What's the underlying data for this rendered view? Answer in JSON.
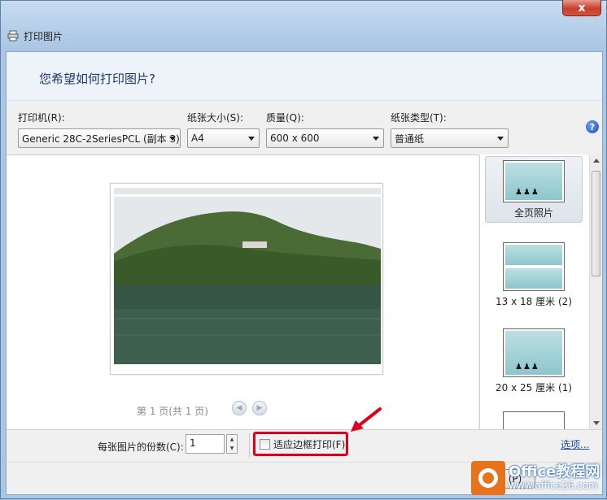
{
  "window": {
    "title": "打印图片",
    "close_label": "x"
  },
  "heading": "您希望如何打印图片?",
  "controls": {
    "printer": {
      "label": "打印机(R):",
      "value": "Generic 28C-2SeriesPCL (副本 3)"
    },
    "paper_size": {
      "label": "纸张大小(S):",
      "value": "A4"
    },
    "quality": {
      "label": "质量(Q):",
      "value": "600 x 600"
    },
    "paper_type": {
      "label": "纸张类型(T):",
      "value": "普通纸"
    },
    "help_icon": "?"
  },
  "preview": {
    "pager_text": "第 1 页(共 1 页)",
    "prev_icon": "◀",
    "next_icon": "▶"
  },
  "layouts": [
    {
      "label": "全页照片",
      "selected": true
    },
    {
      "label": "13 x 18 厘米 (2)",
      "selected": false
    },
    {
      "label": "20 x 25 厘米 (1)",
      "selected": false
    }
  ],
  "bottom": {
    "copies_label": "每张图片的份数(C):",
    "copies_value": "1",
    "fit_label": "适应边框打印(F)",
    "options_link": "选项..."
  },
  "footer": {
    "print_label": "(P)",
    "watermark_brand": "Office教程网",
    "watermark_url": "www.office26.com"
  },
  "colors": {
    "highlight_red": "#e0001b",
    "link_blue": "#1c4ab8",
    "heading_blue": "#1d3a78"
  }
}
